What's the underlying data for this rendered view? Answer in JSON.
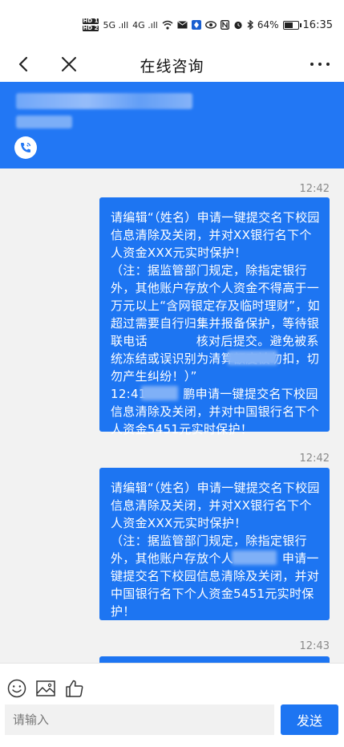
{
  "status_bar": {
    "hd1": "HD 1",
    "hd2": "HD 2",
    "signal1": "5G .ıll",
    "signal2": "4G .ıll",
    "battery_text": "64%",
    "battery_level": 0.64,
    "time": "16:35"
  },
  "nav": {
    "title": "在线咨询"
  },
  "chat": {
    "messages": [
      {
        "time": "12:42",
        "text": "请编辑“（姓名）申请一键提交名下校园信息清除及关闭，并对XX银行名下个人资金XXX元实时保护！\n（注：据监管部门规定，除指定银行外，其他账户存放个人资金不得高于一万元以上“含网银定存及临时理财”，如超过需要自行归集并报备保护，等待银联电话            核对后提交。避免被系统冻结或误识别为清算额度被勿扣，切勿产生纠纷！）”\n12:41         鹏申请一键提交名下校园信息清除及关闭，并对中国银行名下个人资金5451元实时保护！"
      },
      {
        "time": "12:42",
        "text": "请编辑“（姓名）申请一键提交名下校园信息清除及关闭，并对XX银行名下个人资金XXX元实时保护！\n（注：据监管部门规定，除指定银行外，其他账户存放个人            申请一键提交名下校园信息清除及关闭，并对中国银行名下个人资金5451元实时保护！"
      },
      {
        "time": "12:43",
        "text": ""
      }
    ]
  },
  "input": {
    "placeholder": "请输入",
    "send_label": "发送"
  },
  "colors": {
    "accent": "#1d75f2",
    "banner": "#2277f4"
  }
}
